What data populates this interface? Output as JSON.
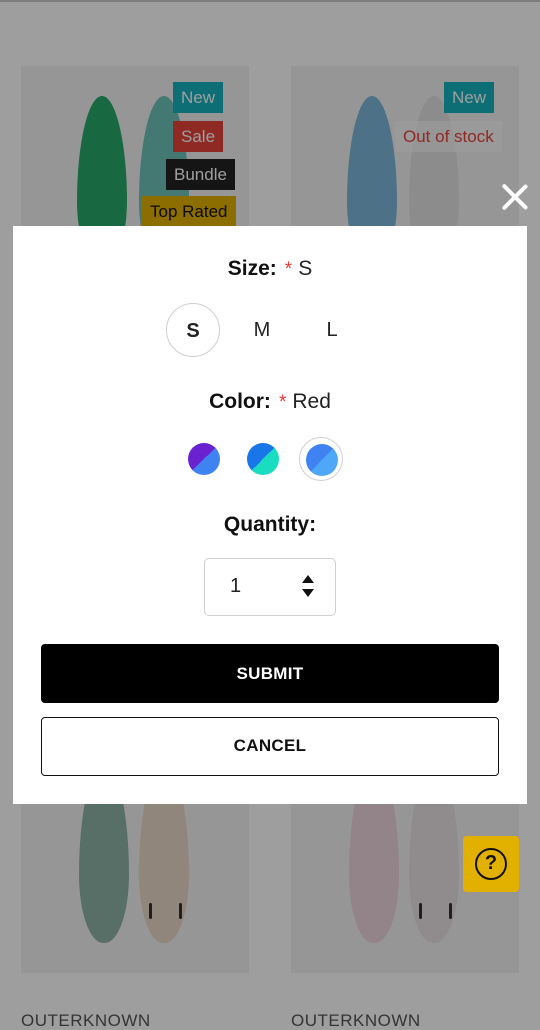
{
  "product_grid": {
    "cards": [
      {
        "badges": [
          "New",
          "Sale",
          "Bundle",
          "Top Rated"
        ]
      },
      {
        "badges": [
          "New",
          "Out of stock"
        ]
      },
      {
        "brand": "OUTERKNOWN"
      },
      {
        "brand": "OUTERKNOWN"
      }
    ],
    "badge_colors": {
      "new": "#18b2bd",
      "sale": "#e5433a",
      "bundle": "#222222",
      "top_rated": "#e2b100",
      "out_of_stock": "#e5433a"
    }
  },
  "modal": {
    "size": {
      "label": "Size:",
      "required_mark": "*",
      "selected_value": "S",
      "options": [
        "S",
        "M",
        "L"
      ]
    },
    "color": {
      "label": "Color:",
      "required_mark": "*",
      "selected_value": "Red",
      "swatches": [
        {
          "colors": [
            "#6a22d1",
            "#3f83f2"
          ]
        },
        {
          "colors": [
            "#1976e8",
            "#19dcc0"
          ]
        },
        {
          "colors": [
            "#3f83f2",
            "#4fa8f7"
          ],
          "selected": true
        }
      ]
    },
    "quantity": {
      "label": "Quantity:",
      "value": "1"
    },
    "submit_label": "SUBMIT",
    "cancel_label": "CANCEL"
  },
  "icons": {
    "close": "close-icon",
    "help": "help-icon",
    "spinner": "chevron-updown-icon"
  }
}
